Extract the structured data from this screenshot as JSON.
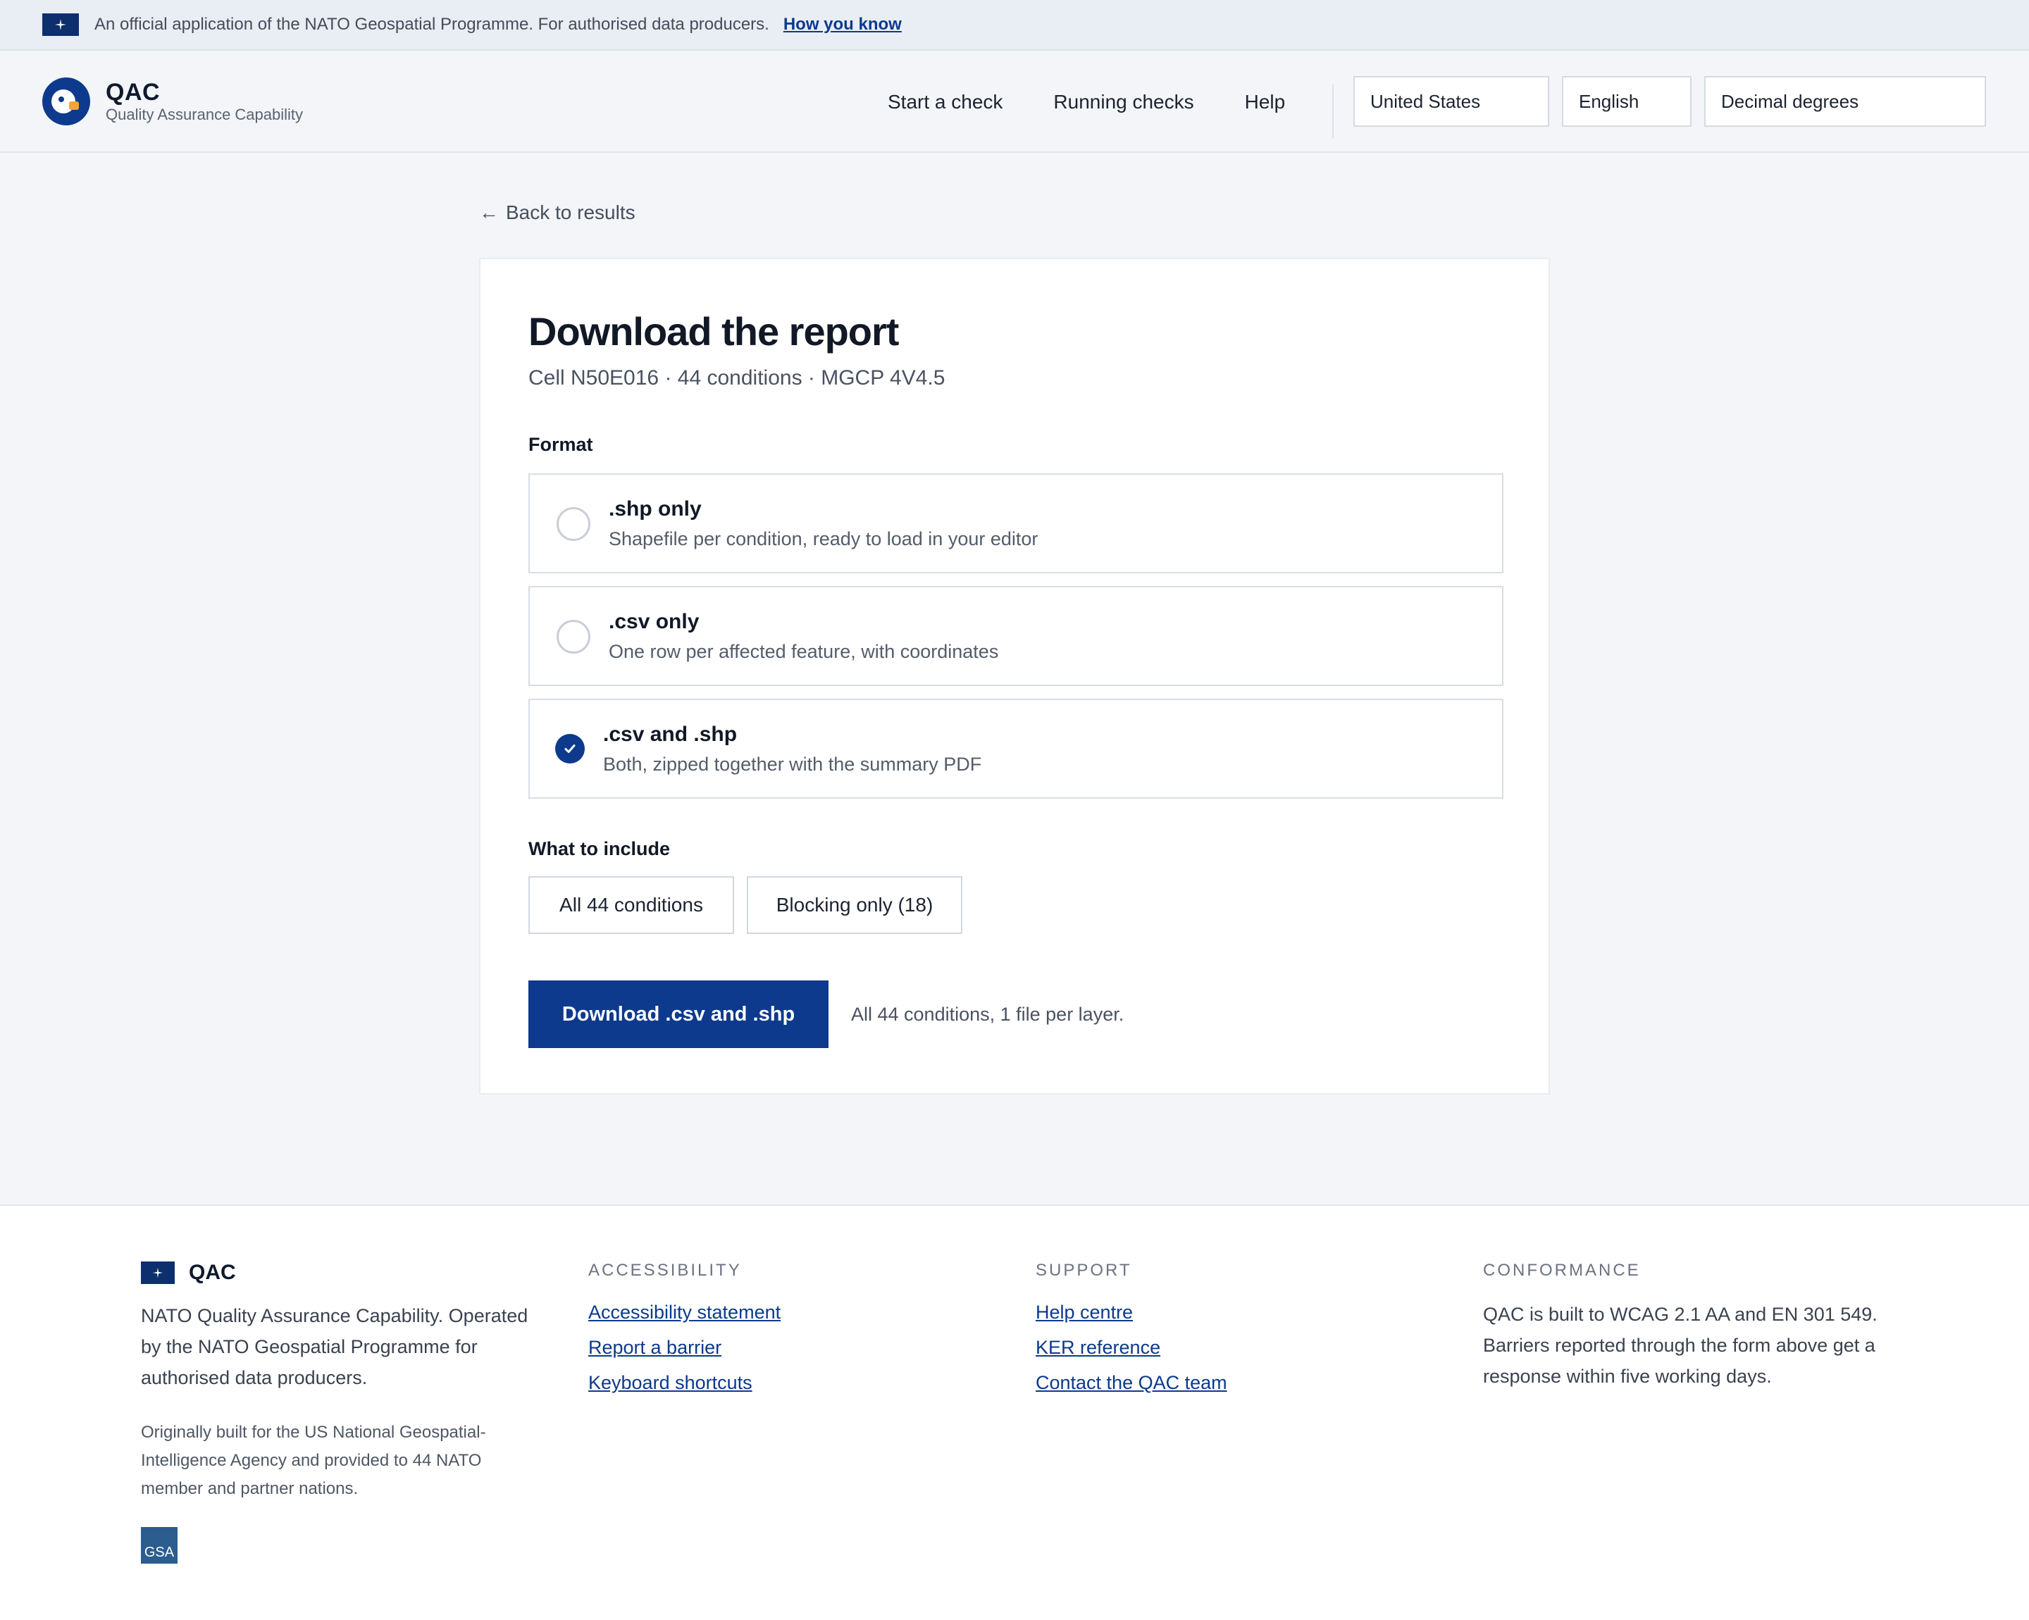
{
  "banner": {
    "text": "An official application of the NATO Geospatial Programme. For authorised data producers.",
    "link": "How you know"
  },
  "header": {
    "app_name": "QAC",
    "app_subtitle": "Quality Assurance Capability",
    "nav": [
      "Start a check",
      "Running checks",
      "Help"
    ],
    "country": "United States",
    "language": "English",
    "coord_format": "Decimal degrees"
  },
  "main": {
    "back_link": "Back to results",
    "title": "Download the report",
    "meta": "Cell N50E016 · 44 conditions · MGCP 4V4.5",
    "format_label": "Format",
    "formats": [
      {
        "title": ".shp only",
        "desc": "Shapefile per condition, ready to load in your editor",
        "selected": false
      },
      {
        "title": ".csv only",
        "desc": "One row per affected feature, with coordinates",
        "selected": false
      },
      {
        "title": ".csv and .shp",
        "desc": "Both, zipped together with the summary PDF",
        "selected": true
      }
    ],
    "include_label": "What to include",
    "include_options": [
      "All 44 conditions",
      "Blocking only (18)"
    ],
    "download_button": "Download .csv and .shp",
    "download_note": "All 44 conditions, 1 file per layer."
  },
  "footer": {
    "brand": "QAC",
    "description": "NATO Quality Assurance Capability. Operated by the NATO Geospatial Programme for authorised data producers.",
    "origin": "Originally built for the US National Geospatial-Intelligence Agency and provided to 44 NATO member and partner nations.",
    "gsa_badge": "GSA",
    "accessibility": {
      "heading": "ACCESSIBILITY",
      "links": [
        "Accessibility statement",
        "Report a barrier",
        "Keyboard shortcuts"
      ]
    },
    "support": {
      "heading": "SUPPORT",
      "links": [
        "Help centre",
        "KER reference",
        "Contact the QAC team"
      ]
    },
    "conformance": {
      "heading": "CONFORMANCE",
      "text": "QAC is built to WCAG 2.1 AA and EN 301 549. Barriers reported through the form above get a response within five working days."
    }
  },
  "colors": {
    "primary": "#0d3a8c",
    "link": "#0b3a8c",
    "background": "#f3f5f8",
    "flag": "#0e2f6e"
  }
}
